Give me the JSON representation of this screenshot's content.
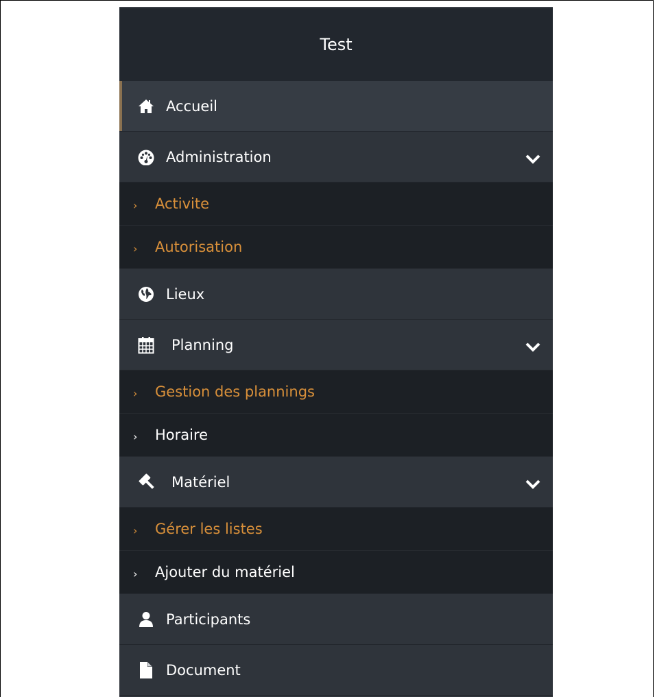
{
  "brand": {
    "title": "Test"
  },
  "menu": {
    "accueil": {
      "label": "Accueil"
    },
    "administration": {
      "label": "Administration",
      "children": [
        {
          "label": "Activite"
        },
        {
          "label": "Autorisation"
        }
      ]
    },
    "lieux": {
      "label": "Lieux"
    },
    "planning": {
      "label": "Planning",
      "children": [
        {
          "label": "Gestion des plannings"
        },
        {
          "label": "Horaire"
        }
      ]
    },
    "materiel": {
      "label": "Matériel",
      "children": [
        {
          "label": "Gérer les listes"
        },
        {
          "label": "Ajouter du matériel"
        }
      ]
    },
    "participants": {
      "label": "Participants"
    },
    "document": {
      "label": "Document"
    }
  },
  "colors": {
    "sidebar_bg": "#2f343b",
    "header_bg": "#22272e",
    "submenu_bg": "#1c2025",
    "accent_orange": "#d9903a",
    "active_marker": "#8a7150"
  },
  "icons": {
    "accueil": "home-icon",
    "administration": "dashboard-icon",
    "lieux": "globe-icon",
    "planning": "calendar-icon",
    "materiel": "gavel-icon",
    "participants": "user-icon",
    "document": "file-icon",
    "expand": "chevron-down-icon",
    "subitem": "chevron-right-icon"
  }
}
